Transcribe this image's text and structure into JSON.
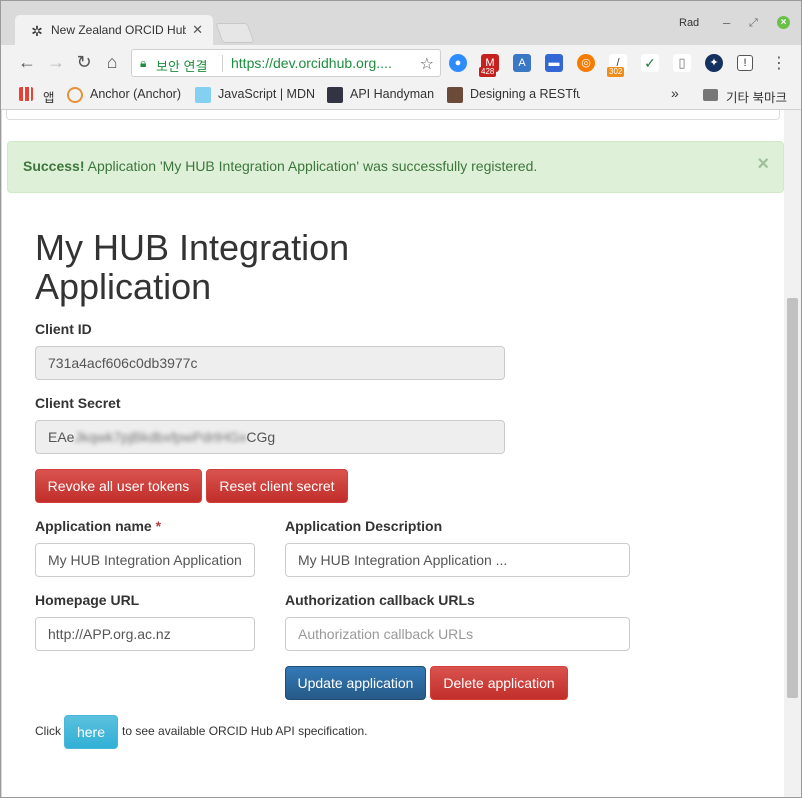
{
  "browser": {
    "tab_title": "New Zealand ORCID Hub",
    "user": "Rad",
    "security_label": "보안 연결",
    "url": "https://dev.orcidhub.org....",
    "extension_badges": {
      "gmail": "428",
      "ext302": "302"
    }
  },
  "bookmarks": {
    "apps": "앱",
    "items": [
      "Anchor (Anchor)",
      "JavaScript | MDN",
      "API Handyman",
      "Designing a RESTful"
    ],
    "overflow": "»",
    "other": "기타 북마크"
  },
  "alert": {
    "strong": "Success!",
    "message": " Application 'My HUB Integration Application' was successfully registered.",
    "close": "×"
  },
  "app": {
    "title": "My HUB Integration Application",
    "client_id_label": "Client ID",
    "client_id": "731a4acf606c0db3977c",
    "client_secret_label": "Client Secret",
    "client_secret_start": "EAe",
    "client_secret_hidden": "Jkqwk7pjBkdbxfpwPdrtHGx",
    "client_secret_end": "CGg",
    "revoke_button": "Revoke all user tokens",
    "reset_button": "Reset client secret",
    "name_label": "Application name",
    "name_required": "*",
    "name_value": "My HUB Integration Application",
    "description_label": "Application Description",
    "description_value": "My HUB Integration Application ...",
    "homepage_label": "Homepage URL",
    "homepage_value": "http://APP.org.ac.nz",
    "callback_label": "Authorization callback URLs",
    "callback_placeholder": "Authorization callback URLs",
    "update_button": "Update application",
    "delete_button": "Delete application",
    "footer_prefix": "Click",
    "here_button": "here",
    "footer_suffix": "to see available ORCID Hub API specification."
  },
  "colors": {
    "success_bg": "#dff0d8",
    "success_text": "#3c763d",
    "danger": "#d9534f",
    "primary": "#286090",
    "info": "#5bc0de"
  }
}
